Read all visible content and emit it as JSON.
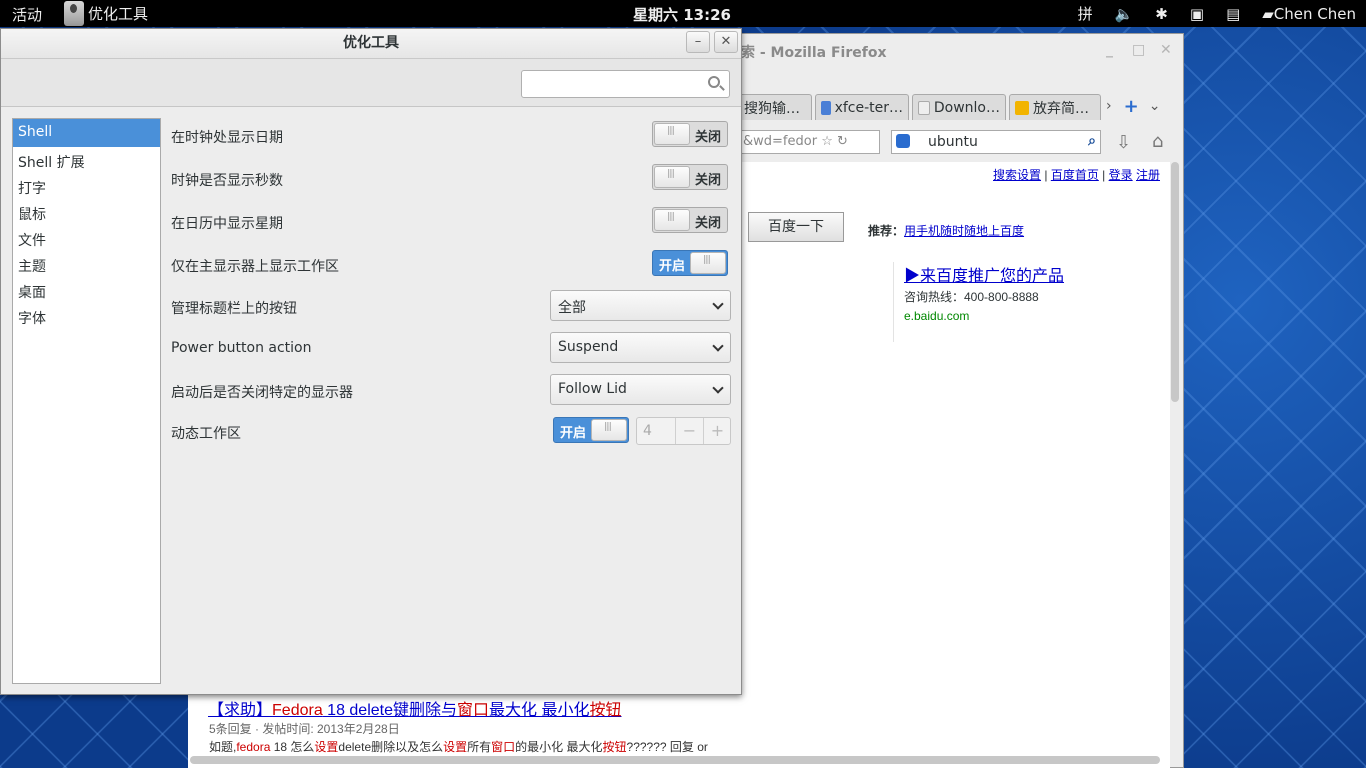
{
  "topbar": {
    "activities": "活动",
    "app_name": "优化工具",
    "clock": "星期六 13:26",
    "input_method": "拼",
    "user": "Chen Chen"
  },
  "firefox": {
    "title_fragment": "索  -  Mozilla Firefox",
    "tabs": [
      {
        "label": "搜狗输…",
        "icon": "sogou-icon"
      },
      {
        "label": "xfce-ter…",
        "icon": "google-icon"
      },
      {
        "label": "Downlo…",
        "icon": "wiki-icon"
      },
      {
        "label": "放弃简…",
        "icon": "baidu-icon"
      }
    ],
    "url_fragment": "&wd=fedor",
    "search_value": "ubuntu",
    "top_links": [
      "搜索设置",
      "百度首页",
      "登录",
      "注册"
    ],
    "baidu_button": "百度一下",
    "recommend_label": "推荐：",
    "recommend_link": "用手机随时随地上百度",
    "ad_title": "▶来百度推广您的产品",
    "ad_phone": "咨询热线：400-800-8888",
    "ad_url": "e.baidu.com",
    "result": {
      "title_parts": [
        "【求助】",
        "Fedora",
        " 18 delete键删除与",
        "窗口",
        "最大化 最小化",
        "按钮"
      ],
      "meta": "5条回复 · 发帖时间: 2013年2月28日",
      "snippet_parts": [
        "如题,",
        "fedora",
        " 18 怎么",
        "设置",
        "delete删除以及怎么",
        "设置",
        "所有",
        "窗口",
        "的最小化 最大化",
        "按钮",
        "?????? 回复 or"
      ]
    }
  },
  "tweak": {
    "title": "优化工具",
    "minimize_label": "–",
    "close_label": "✕",
    "search_placeholder": "",
    "sidebar": [
      {
        "label": "Shell",
        "selected": true
      },
      {
        "label": "Shell 扩展",
        "selected": false
      },
      {
        "label": "打字",
        "selected": false
      },
      {
        "label": "鼠标",
        "selected": false
      },
      {
        "label": "文件",
        "selected": false
      },
      {
        "label": "主题",
        "selected": false
      },
      {
        "label": "桌面",
        "selected": false
      },
      {
        "label": "字体",
        "selected": false
      }
    ],
    "settings": {
      "show_date": {
        "label": "在时钟处显示日期",
        "state": "关闭"
      },
      "show_seconds": {
        "label": "时钟是否显示秒数",
        "state": "关闭"
      },
      "show_week": {
        "label": "在日历中显示星期",
        "state": "关闭"
      },
      "primary_workspace": {
        "label": "仅在主显示器上显示工作区",
        "state": "开启"
      },
      "titlebar_buttons": {
        "label": "管理标题栏上的按钮",
        "value": "全部"
      },
      "power_button": {
        "label": "Power button action",
        "value": "Suspend"
      },
      "lid_close": {
        "label": "启动后是否关闭特定的显示器",
        "value": "Follow Lid"
      },
      "dynamic_workspaces": {
        "label": "动态工作区",
        "state": "开启",
        "count": "4",
        "minus": "−",
        "plus": "+"
      }
    }
  }
}
